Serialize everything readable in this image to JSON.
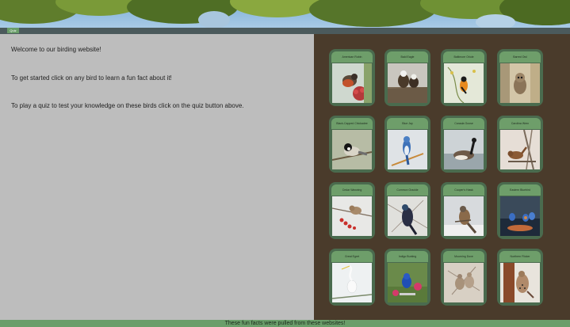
{
  "nav": {
    "quiz_label": "Quiz"
  },
  "intro": {
    "welcome": "Welcome to our birding website!",
    "instruction": "To get started click on any bird to learn a fun fact about it!",
    "quiz": "To play a quiz to test your knowledge on these birds click on the quiz button above."
  },
  "birds": [
    {
      "name": "American Robin",
      "icon": "robin-photo"
    },
    {
      "name": "Bald Eagle",
      "icon": "eagle-photo"
    },
    {
      "name": "Baltimore Oriole",
      "icon": "oriole-photo"
    },
    {
      "name": "Barred Owl",
      "icon": "owl-photo"
    },
    {
      "name": "Black-Capped Chickadee",
      "icon": "chickadee-photo"
    },
    {
      "name": "Blue Jay",
      "icon": "bluejay-photo"
    },
    {
      "name": "Canada Goose",
      "icon": "goose-photo"
    },
    {
      "name": "Carolina Wren",
      "icon": "wren-photo"
    },
    {
      "name": "Cedar Waxwing",
      "icon": "waxwing-photo"
    },
    {
      "name": "Common Grackle",
      "icon": "grackle-photo"
    },
    {
      "name": "Cooper's Hawk",
      "icon": "hawk-photo"
    },
    {
      "name": "Eastern Bluebird",
      "icon": "bluebird-photo"
    },
    {
      "name": "Great Egret",
      "icon": "egret-photo"
    },
    {
      "name": "Indigo Bunting",
      "icon": "bunting-photo"
    },
    {
      "name": "Mourning Dove",
      "icon": "dove-photo"
    },
    {
      "name": "Northern Flicker",
      "icon": "flicker-photo"
    }
  ],
  "footer": {
    "text": "These fun facts were pulled from these websites!"
  },
  "colors": {
    "nav_bg": "#4b5a5c",
    "accent_green": "#6a9e6a",
    "panel_brown": "#4a3b2b",
    "card_green": "#4a6b4e",
    "left_bg": "#bdbdbd"
  }
}
